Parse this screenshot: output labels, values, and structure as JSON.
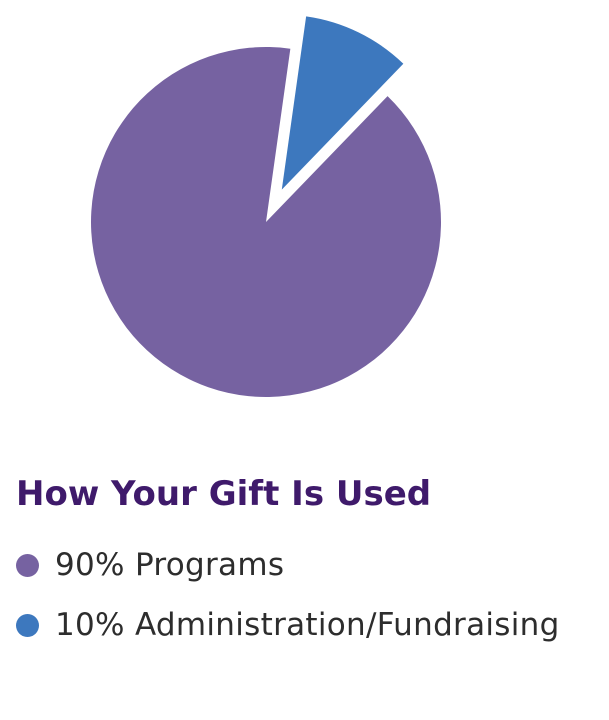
{
  "chart_data": {
    "type": "pie",
    "title": "How Your Gift Is Used",
    "slices": [
      {
        "label": "90% Programs",
        "value": 90,
        "color": "#7662a1"
      },
      {
        "label": "10% Administration/Fundraising",
        "value": 10,
        "color": "#3d78be",
        "exploded": true
      }
    ],
    "legend_position": "bottom-left"
  }
}
